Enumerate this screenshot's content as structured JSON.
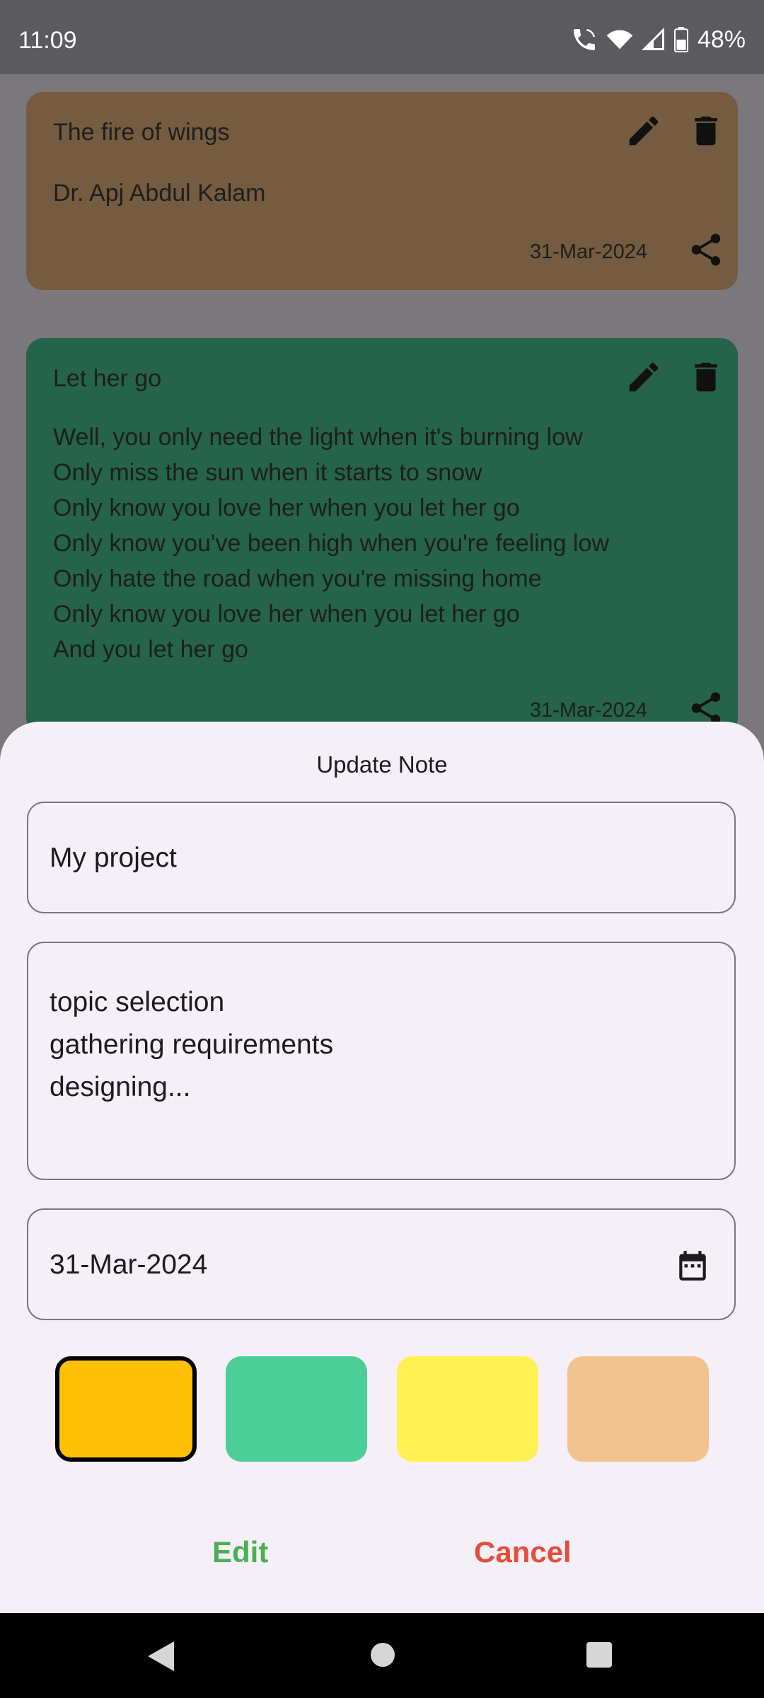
{
  "status_bar": {
    "time": "11:09",
    "battery": "48%"
  },
  "notes": [
    {
      "title": "The fire of wings",
      "body": "Dr. Apj Abdul Kalam",
      "date": "31-Mar-2024",
      "color": "#755b3f"
    },
    {
      "title": "Let her go",
      "body": "Well, you only need the light when it's burning low\nOnly miss the sun when it starts to snow\nOnly know you love her when you let her go\nOnly know you've been high when you're feeling low\nOnly hate the road when you're missing home\nOnly know you love her when you let her go\nAnd you let her go",
      "date": "31-Mar-2024",
      "color": "#25634a"
    }
  ],
  "dialog": {
    "title": "Update Note",
    "title_value": "My project",
    "content_value": "topic selection\ngathering requirements\ndesigning...",
    "date_value": "31-Mar-2024",
    "colors": [
      "#ffc107",
      "#4cce99",
      "#fff154",
      "#f2c28f"
    ],
    "selected_color_index": 0,
    "edit_label": "Edit",
    "cancel_label": "Cancel",
    "edit_color": "#4caf50",
    "cancel_color": "#e74c3c"
  }
}
